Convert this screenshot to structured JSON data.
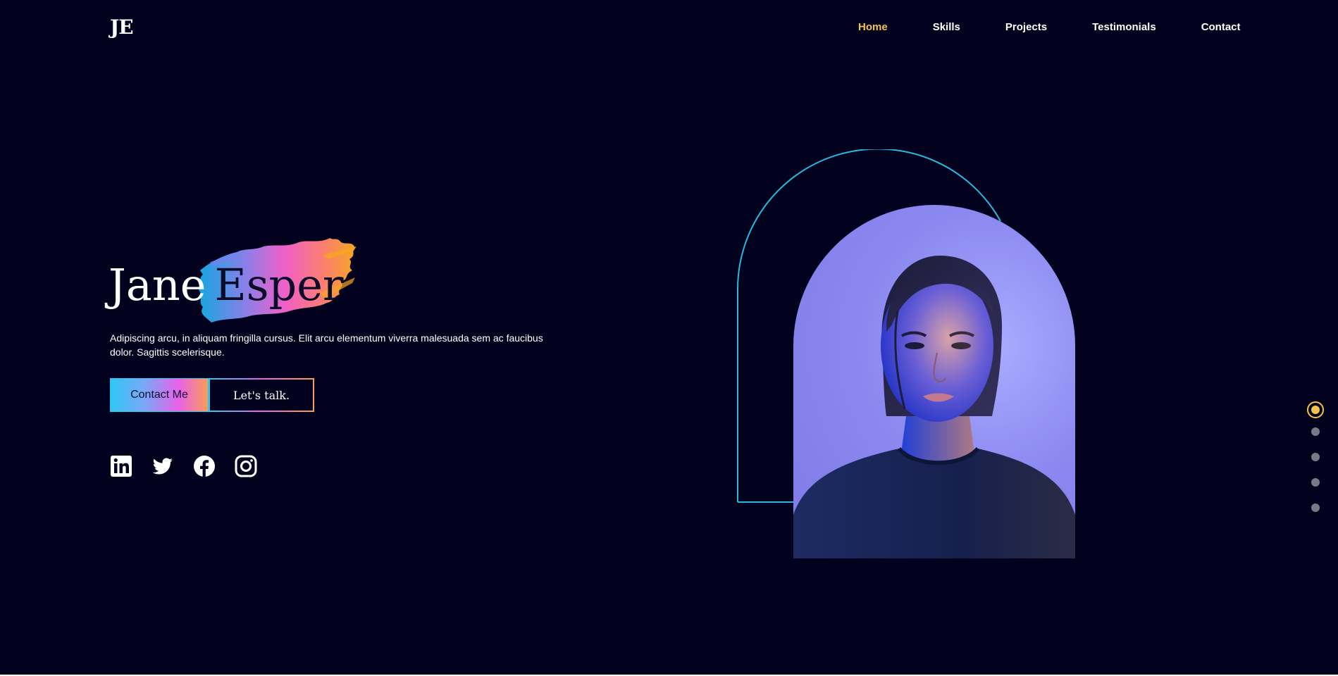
{
  "header": {
    "logo": "JE",
    "nav": [
      {
        "label": "Home",
        "active": true
      },
      {
        "label": "Skills",
        "active": false
      },
      {
        "label": "Projects",
        "active": false
      },
      {
        "label": "Testimonials",
        "active": false
      },
      {
        "label": "Contact",
        "active": false
      }
    ]
  },
  "hero": {
    "first_name": "Jane",
    "last_name": "Esper",
    "description": "Adipiscing arcu, in aliquam fringilla cursus. Elit arcu elementum viverra malesuada sem ac faucibus dolor. Sagittis scelerisque.",
    "contact_button": "Contact Me",
    "talk_button": "Let's talk."
  },
  "socials": [
    {
      "icon": "linkedin-icon"
    },
    {
      "icon": "twitter-icon"
    },
    {
      "icon": "facebook-icon"
    },
    {
      "icon": "instagram-icon"
    }
  ],
  "slide_dots": {
    "count": 5,
    "active_index": 0
  },
  "colors": {
    "background": "#02021f",
    "accent": "#f2c14e",
    "gradient_start": "#2fc7f4",
    "gradient_mid": "#e862e8",
    "gradient_end": "#fb9c58",
    "arch_outline": "#27b8e0",
    "inactive_dot": "#7a7a86"
  }
}
